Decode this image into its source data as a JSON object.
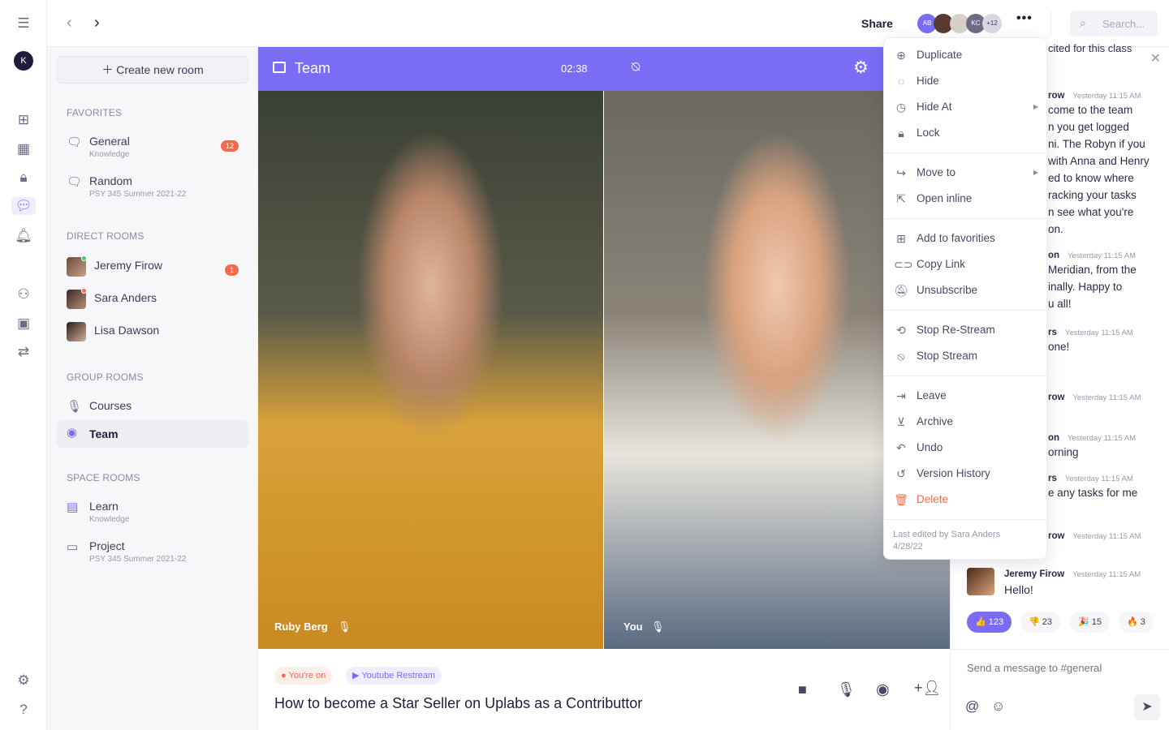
{
  "rail": {
    "avatar": "K",
    "icons": [
      "menu-collapse-icon",
      "add-square-icon",
      "grid-icon",
      "lock-icon",
      "chat-icon",
      "bell-icon",
      "people-icon",
      "calendar-icon",
      "flow-icon",
      "gear-icon",
      "help-icon"
    ]
  },
  "topbar": {
    "share": "Share",
    "avatars": [
      "AB",
      "KC"
    ],
    "more_count": "+12",
    "search_placeholder": "Search..."
  },
  "sidebar": {
    "create": "Create new room",
    "favorites_title": "FAVORITES",
    "favorites": [
      {
        "name": "General",
        "sub": "Knowledge",
        "badge": "12"
      },
      {
        "name": "Random",
        "sub": "PSY 345 Summer 2021-22"
      }
    ],
    "direct_title": "DIRECT ROOMS",
    "direct": [
      {
        "name": "Jeremy Firow",
        "badge": "1"
      },
      {
        "name": "Sara Anders"
      },
      {
        "name": "Lisa Dawson"
      }
    ],
    "group_title": "GROUP ROOMS",
    "group": [
      {
        "name": "Courses"
      },
      {
        "name": "Team"
      }
    ],
    "space_title": "SPACE ROOMS",
    "space": [
      {
        "name": "Learn",
        "sub": "Knowledge"
      },
      {
        "name": "Project",
        "sub": "PSY 345 Summer 2021-22"
      }
    ]
  },
  "video": {
    "title": "Team",
    "timer": "02:38",
    "left_name": "Ruby Berg",
    "right_name": "You",
    "accent": "#7b6cf6"
  },
  "bottom": {
    "live": "You're on",
    "restream": "Youtube Restream",
    "title": "How to become a Star Seller on Uplabs as a Contributtor"
  },
  "menu": {
    "items": [
      [
        "Duplicate",
        "Hide",
        "Hide At",
        "Lock"
      ],
      [
        "Move to",
        "Open inline"
      ],
      [
        "Add to favorities",
        "Copy Link",
        "Unsubscribe"
      ],
      [
        "Stop Re-Stream",
        "Stop Stream"
      ],
      [
        "Leave",
        "Archive",
        "Undo",
        "Version History",
        "Delete"
      ]
    ],
    "footer1": "Last edited by Sara Anders",
    "footer2": "4/28/22"
  },
  "chat": {
    "top": "cited for this class",
    "messages": [
      {
        "author": "row",
        "time": "Yesterday 11:15 AM",
        "lines": [
          "come to the team",
          "n you get logged",
          "ni. The Robyn if you",
          "with Anna and Henry",
          "ed to know where",
          "racking your tasks",
          "n see what you're",
          "on."
        ]
      },
      {
        "author": "on",
        "time": "Yesterday 11:15 AM",
        "lines": [
          "Meridian, from the",
          "inally. Happy to",
          "u all!"
        ]
      },
      {
        "author": "rs",
        "time": "Yesterday 11:15 AM",
        "lines": [
          "one!"
        ]
      },
      {
        "author": "row",
        "time": "Yesterday 11:15 AM",
        "lines": []
      },
      {
        "author": "on",
        "time": "Yesterday 11:15 AM",
        "lines": [
          "orning"
        ]
      },
      {
        "author": "rs",
        "time": "Yesterday 11:15 AM",
        "lines": [
          "e any tasks for me"
        ]
      },
      {
        "author": "row",
        "time": "Yesterday 11:15 AM",
        "lines": []
      }
    ],
    "last": {
      "author": "Jeremy Firow",
      "time": "Yesterday 11:15 AM",
      "text": "Hello!"
    },
    "reactions": [
      {
        "emoji": "👍",
        "count": "123"
      },
      {
        "emoji": "👎",
        "count": "23"
      },
      {
        "emoji": "🎉",
        "count": "15"
      },
      {
        "emoji": "🔥",
        "count": "3"
      }
    ],
    "placeholder": "Send a message to #general"
  }
}
